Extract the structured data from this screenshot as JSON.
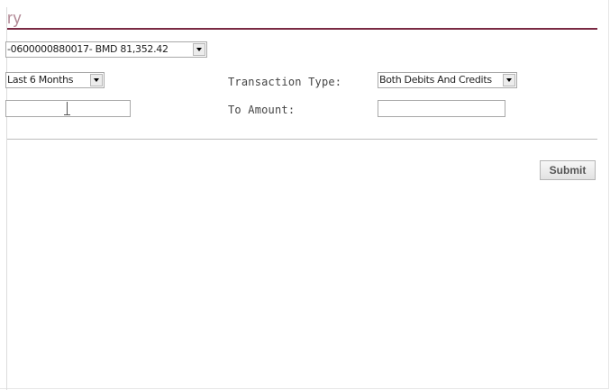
{
  "page": {
    "heading": "ry"
  },
  "account_select": {
    "value": "-0600000880017- BMD 81,352.42"
  },
  "period_select": {
    "value": "Last 6 Months"
  },
  "transaction_type": {
    "label": "Transaction Type:",
    "value": "Both Debits And Credits"
  },
  "from_amount": {
    "value": ""
  },
  "to_amount": {
    "label": "To Amount:",
    "value": ""
  },
  "actions": {
    "submit_label": "Submit"
  },
  "colors": {
    "heading_text": "#b38a97",
    "heading_rule": "#7a2a44"
  }
}
